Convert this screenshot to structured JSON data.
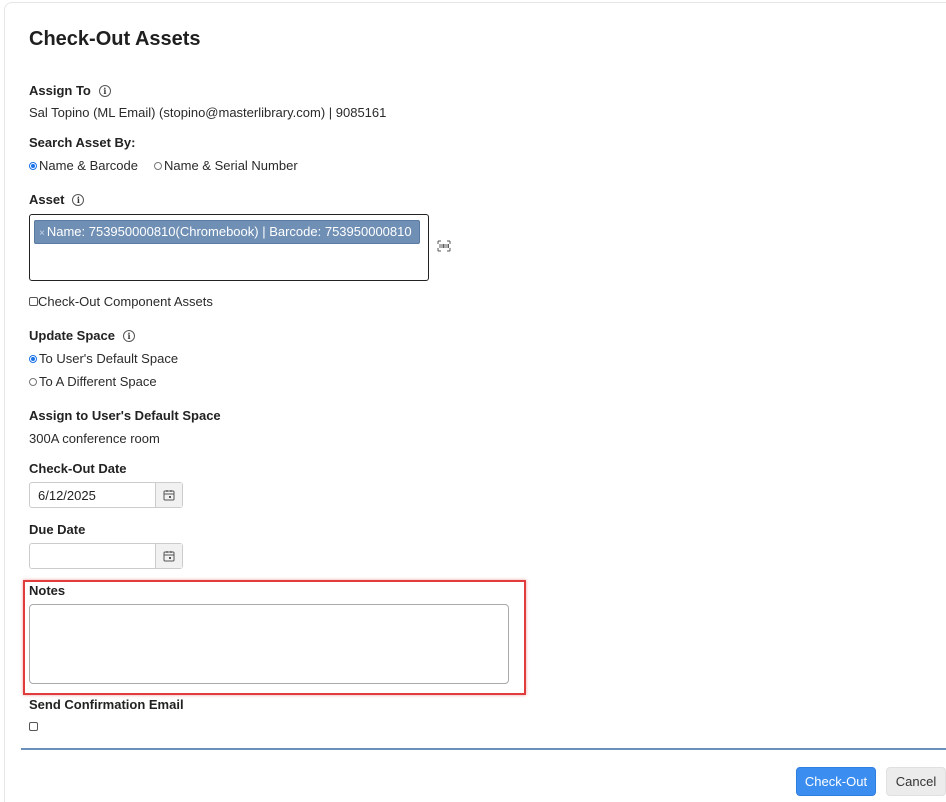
{
  "dialog": {
    "title": "Check-Out Assets"
  },
  "assign_to": {
    "label": "Assign To",
    "value": "Sal Topino (ML Email) (stopino@masterlibrary.com) | 9085161"
  },
  "search_by": {
    "label": "Search Asset By:",
    "options": [
      {
        "label": "Name & Barcode",
        "checked": true
      },
      {
        "label": "Name & Serial Number",
        "checked": false
      }
    ]
  },
  "asset": {
    "label": "Asset",
    "selected_tag": "Name: 753950000810(Chromebook) | Barcode: 753950000810",
    "remove_symbol": "×",
    "scan_icon": "barcode-scan-icon"
  },
  "component_assets": {
    "label": "Check-Out Component Assets",
    "checked": false
  },
  "update_space": {
    "label": "Update Space",
    "options": [
      {
        "label": "To User's Default Space",
        "checked": true
      },
      {
        "label": "To A Different Space",
        "checked": false
      }
    ]
  },
  "default_space": {
    "label": "Assign to User's Default Space",
    "value": "300A conference room"
  },
  "checkout_date": {
    "label": "Check-Out Date",
    "value": "6/12/2025"
  },
  "due_date": {
    "label": "Due Date",
    "value": ""
  },
  "notes": {
    "label": "Notes",
    "value": ""
  },
  "confirmation_email": {
    "label": "Send Confirmation Email",
    "checked": false
  },
  "footer": {
    "checkout_label": "Check-Out",
    "cancel_label": "Cancel"
  },
  "colors": {
    "accent": "#3b8ef0",
    "tag_bg": "#6f8fb5",
    "highlight": "#e03c3c",
    "divider": "#6b8fb8"
  }
}
